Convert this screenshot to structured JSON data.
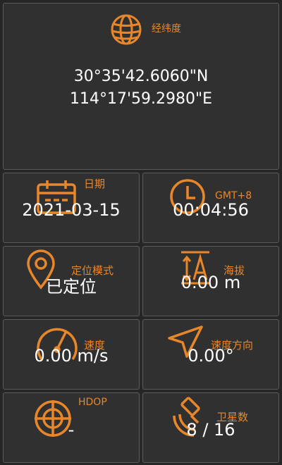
{
  "accent": "#e8872a",
  "coords_card": {
    "icon": "globe-icon",
    "label": "经纬度",
    "latitude": "30°35'42.6060\"N",
    "longitude": "114°17'59.2980\"E"
  },
  "date_card": {
    "icon": "calendar-icon",
    "label": "日期",
    "value": "2021-03-15"
  },
  "time_card": {
    "icon": "clock-icon",
    "label": "GMT+8",
    "value": "00:04:56"
  },
  "mode_card": {
    "icon": "location-pin-icon",
    "label": "定位模式",
    "value": "已定位"
  },
  "altitude_card": {
    "icon": "altitude-icon",
    "label": "海拔",
    "value": "0.00 m"
  },
  "speed_card": {
    "icon": "speedometer-icon",
    "label": "速度",
    "value": "0.00 m/s"
  },
  "heading_card": {
    "icon": "navigation-arrow-icon",
    "label": "速度方向",
    "value": "0.00°"
  },
  "hdop_card": {
    "icon": "crosshair-icon",
    "label": "HDOP",
    "value": "-"
  },
  "satellite_card": {
    "icon": "satellite-icon",
    "label": "卫星数",
    "value": "8 / 16"
  }
}
